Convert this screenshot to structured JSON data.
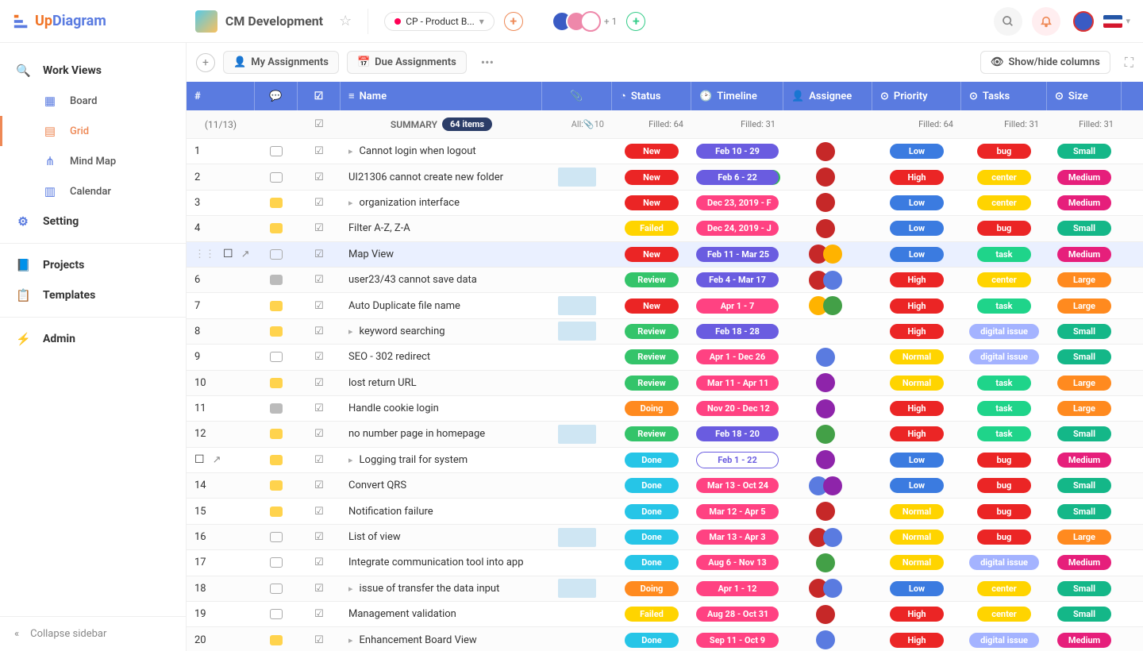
{
  "header": {
    "logo1": "Up",
    "logo2": "Diagram",
    "project": "CM Development",
    "phase": "CP - Product B...",
    "avatar_plus": "+ 1",
    "flag": "en"
  },
  "sidebar": {
    "work_views": "Work Views",
    "items": [
      {
        "icon": "board",
        "label": "Board"
      },
      {
        "icon": "grid",
        "label": "Grid"
      },
      {
        "icon": "mindmap",
        "label": "Mind Map"
      },
      {
        "icon": "calendar",
        "label": "Calendar"
      }
    ],
    "setting": "Setting",
    "projects": "Projects",
    "templates": "Templates",
    "admin": "Admin",
    "collapse": "Collapse sidebar"
  },
  "toolbar": {
    "my_assign": "My Assignments",
    "due_assign": "Due Assignments",
    "showhide": "Show/hide columns"
  },
  "columns": {
    "num": "#",
    "name": "Name",
    "status": "Status",
    "timeline": "Timeline",
    "assignee": "Assignee",
    "priority": "Priority",
    "tasks": "Tasks",
    "size": "Size"
  },
  "summary": {
    "frac": "(11/13)",
    "label": "SUMMARY",
    "count": "64 items",
    "att": "All:",
    "att_n": "10",
    "status": "Filled: 64",
    "timeline": "Filled: 31",
    "priority": "Filled: 64",
    "tasks": "Filled: 31",
    "size": "Filled: 31"
  },
  "colors": {
    "red": "#eb2525",
    "green": "#34c46a",
    "lime": "#1fd48a",
    "yellow": "#ffd400",
    "orange": "#ff8a1f",
    "cyan": "#26c5e7",
    "purple": "#6a5ce0",
    "violet": "#9a52e0",
    "pink": "#e646a4",
    "magenta": "#e61f7b",
    "blue": "#3b7be0",
    "teal": "#14b788",
    "pinkred": "#ff4282",
    "lav": "#a4b3ff",
    "dblue": "#4d6cf0"
  },
  "rows": [
    {
      "n": "1",
      "chat": "empty",
      "name": "Cannot login when logout",
      "caret": true,
      "att": 0,
      "status": {
        "t": "New",
        "c": "red"
      },
      "time": {
        "t": "Feb 10 - 29",
        "c": "purple"
      },
      "asg": [
        "a1"
      ],
      "pri": {
        "t": "Low",
        "c": "blue"
      },
      "task": {
        "t": "bug",
        "c": "red"
      },
      "size": {
        "t": "Small",
        "c": "teal"
      }
    },
    {
      "n": "2",
      "chat": "empty",
      "name": "UI21306 cannot create new folder",
      "caret": false,
      "att": 1,
      "status": {
        "t": "New",
        "c": "red"
      },
      "time": {
        "t": "Feb 6 - 22",
        "c": "purple",
        "sel": true
      },
      "asg": [
        "a1"
      ],
      "pri": {
        "t": "High",
        "c": "red"
      },
      "task": {
        "t": "center",
        "c": "yellow"
      },
      "size": {
        "t": "Medium",
        "c": "magenta"
      }
    },
    {
      "n": "3",
      "chat": "yellow",
      "name": "organization interface",
      "caret": true,
      "att": 0,
      "status": {
        "t": "New",
        "c": "red"
      },
      "time": {
        "t": "Dec 23, 2019 - F",
        "c": "pinkred"
      },
      "asg": [
        "a1"
      ],
      "pri": {
        "t": "Low",
        "c": "blue"
      },
      "task": {
        "t": "center",
        "c": "yellow"
      },
      "size": {
        "t": "Medium",
        "c": "magenta"
      }
    },
    {
      "n": "4",
      "chat": "yellow",
      "name": "Filter A-Z, Z-A",
      "caret": false,
      "att": 0,
      "status": {
        "t": "Failed",
        "c": "yellow"
      },
      "time": {
        "t": "Dec 24, 2019 - J",
        "c": "pinkred"
      },
      "asg": [
        "a1"
      ],
      "pri": {
        "t": "Low",
        "c": "blue"
      },
      "task": {
        "t": "bug",
        "c": "red"
      },
      "size": {
        "t": "Small",
        "c": "teal"
      }
    },
    {
      "n": "",
      "chat": "empty",
      "name": "Map View",
      "caret": false,
      "att": 0,
      "status": {
        "t": "New",
        "c": "red"
      },
      "time": {
        "t": "Feb 11 - Mar 25",
        "c": "purple"
      },
      "asg": [
        "a1",
        "a2"
      ],
      "pri": {
        "t": "Low",
        "c": "blue"
      },
      "task": {
        "t": "task",
        "c": "lime"
      },
      "size": {
        "t": "Medium",
        "c": "magenta"
      },
      "hov": true,
      "checkbox": true,
      "open": true
    },
    {
      "n": "6",
      "chat": "gray",
      "name": "user23/43 cannot save data",
      "caret": false,
      "att": 0,
      "status": {
        "t": "Review",
        "c": "green"
      },
      "time": {
        "t": "Feb 4 - Mar 17",
        "c": "purple"
      },
      "asg": [
        "a1",
        "a3"
      ],
      "pri": {
        "t": "High",
        "c": "red"
      },
      "task": {
        "t": "center",
        "c": "yellow"
      },
      "size": {
        "t": "Large",
        "c": "orange"
      }
    },
    {
      "n": "7",
      "chat": "yellow",
      "name": "Auto Duplicate file name",
      "caret": false,
      "att": 1,
      "status": {
        "t": "New",
        "c": "red"
      },
      "time": {
        "t": "Apr 1 - 7",
        "c": "pinkred"
      },
      "asg": [
        "a2",
        "a5"
      ],
      "pri": {
        "t": "High",
        "c": "red"
      },
      "task": {
        "t": "task",
        "c": "lime"
      },
      "size": {
        "t": "Large",
        "c": "orange"
      }
    },
    {
      "n": "8",
      "chat": "yellow",
      "name": "keyword searching",
      "caret": true,
      "att": 1,
      "status": {
        "t": "Review",
        "c": "green"
      },
      "time": {
        "t": "Feb 18 - 28",
        "c": "purple"
      },
      "asg": [],
      "pri": {
        "t": "High",
        "c": "red"
      },
      "task": {
        "t": "digital issue",
        "c": "lav"
      },
      "size": {
        "t": "Small",
        "c": "teal"
      }
    },
    {
      "n": "9",
      "chat": "empty",
      "name": "SEO - 302 redirect",
      "caret": false,
      "att": 0,
      "status": {
        "t": "Review",
        "c": "green"
      },
      "time": {
        "t": "Apr 1 - Dec 26",
        "c": "pinkred"
      },
      "asg": [
        "a3"
      ],
      "pri": {
        "t": "Normal",
        "c": "yellow"
      },
      "task": {
        "t": "digital issue",
        "c": "lav"
      },
      "size": {
        "t": "Small",
        "c": "teal"
      }
    },
    {
      "n": "10",
      "chat": "yellow",
      "name": "lost return URL",
      "caret": false,
      "att": 0,
      "status": {
        "t": "Review",
        "c": "green"
      },
      "time": {
        "t": "Mar 11 - Apr 11",
        "c": "pinkred"
      },
      "asg": [
        "a4"
      ],
      "pri": {
        "t": "Normal",
        "c": "yellow"
      },
      "task": {
        "t": "task",
        "c": "lime"
      },
      "size": {
        "t": "Large",
        "c": "orange"
      }
    },
    {
      "n": "11",
      "chat": "gray",
      "name": "Handle cookie login",
      "caret": false,
      "att": 0,
      "status": {
        "t": "Doing",
        "c": "orange"
      },
      "time": {
        "t": "Nov 20 - Dec 12",
        "c": "pinkred"
      },
      "asg": [
        "a4"
      ],
      "pri": {
        "t": "High",
        "c": "red"
      },
      "task": {
        "t": "task",
        "c": "lime"
      },
      "size": {
        "t": "Large",
        "c": "orange"
      }
    },
    {
      "n": "12",
      "chat": "yellow",
      "name": "no number page in homepage",
      "caret": false,
      "att": 1,
      "status": {
        "t": "Review",
        "c": "green"
      },
      "time": {
        "t": "Feb 18 - 20",
        "c": "purple"
      },
      "asg": [
        "a5"
      ],
      "pri": {
        "t": "High",
        "c": "red"
      },
      "task": {
        "t": "task",
        "c": "lime"
      },
      "size": {
        "t": "Small",
        "c": "teal"
      }
    },
    {
      "n": "",
      "chat": "yellow",
      "name": "Logging trail for system",
      "caret": true,
      "att": 0,
      "status": {
        "t": "Done",
        "c": "cyan"
      },
      "time": {
        "t": "Feb 1 - 22",
        "c": "purple",
        "boxed": true
      },
      "asg": [
        "a4"
      ],
      "pri": {
        "t": "Low",
        "c": "blue"
      },
      "task": {
        "t": "bug",
        "c": "red"
      },
      "size": {
        "t": "Medium",
        "c": "magenta"
      },
      "checkbox": true,
      "open": true
    },
    {
      "n": "14",
      "chat": "yellow",
      "name": "Convert QRS",
      "caret": false,
      "att": 0,
      "status": {
        "t": "Done",
        "c": "cyan"
      },
      "time": {
        "t": "Mar 13 - Oct 24",
        "c": "pinkred"
      },
      "asg": [
        "a3",
        "a4"
      ],
      "pri": {
        "t": "Low",
        "c": "blue"
      },
      "task": {
        "t": "bug",
        "c": "red"
      },
      "size": {
        "t": "Small",
        "c": "teal"
      }
    },
    {
      "n": "15",
      "chat": "yellow",
      "name": "Notification failure",
      "caret": false,
      "att": 0,
      "status": {
        "t": "Done",
        "c": "cyan"
      },
      "time": {
        "t": "Mar 12 - Apr 5",
        "c": "pinkred"
      },
      "asg": [
        "a1"
      ],
      "pri": {
        "t": "Normal",
        "c": "yellow"
      },
      "task": {
        "t": "bug",
        "c": "red"
      },
      "size": {
        "t": "Small",
        "c": "teal"
      }
    },
    {
      "n": "16",
      "chat": "empty",
      "name": "List of view",
      "caret": false,
      "att": 1,
      "status": {
        "t": "Done",
        "c": "cyan"
      },
      "time": {
        "t": "Mar 13 - Apr 3",
        "c": "pinkred"
      },
      "asg": [
        "a1",
        "a3"
      ],
      "pri": {
        "t": "Normal",
        "c": "yellow"
      },
      "task": {
        "t": "bug",
        "c": "red"
      },
      "size": {
        "t": "Large",
        "c": "orange"
      }
    },
    {
      "n": "17",
      "chat": "empty",
      "name": "Integrate communication tool into app",
      "caret": false,
      "att": 0,
      "status": {
        "t": "Done",
        "c": "cyan"
      },
      "time": {
        "t": "Aug 6 - Nov 13",
        "c": "pinkred"
      },
      "asg": [
        "a5"
      ],
      "pri": {
        "t": "Normal",
        "c": "yellow"
      },
      "task": {
        "t": "digital issue",
        "c": "lav"
      },
      "size": {
        "t": "Medium",
        "c": "magenta"
      }
    },
    {
      "n": "18",
      "chat": "empty",
      "name": "issue of transfer the data input",
      "caret": true,
      "att": 1,
      "status": {
        "t": "Doing",
        "c": "orange"
      },
      "time": {
        "t": "Apr 1 - 12",
        "c": "pinkred"
      },
      "asg": [
        "a1",
        "a3"
      ],
      "pri": {
        "t": "Low",
        "c": "blue"
      },
      "task": {
        "t": "center",
        "c": "yellow"
      },
      "size": {
        "t": "Small",
        "c": "teal"
      }
    },
    {
      "n": "19",
      "chat": "empty",
      "name": "Management validation",
      "caret": false,
      "att": 0,
      "status": {
        "t": "Failed",
        "c": "yellow"
      },
      "time": {
        "t": "Aug 28 - Oct 31",
        "c": "pinkred"
      },
      "asg": [
        "a1"
      ],
      "pri": {
        "t": "High",
        "c": "red"
      },
      "task": {
        "t": "center",
        "c": "yellow"
      },
      "size": {
        "t": "Small",
        "c": "teal"
      }
    },
    {
      "n": "20",
      "chat": "yellow",
      "name": "Enhancement Board View",
      "caret": true,
      "att": 0,
      "status": {
        "t": "Done",
        "c": "cyan"
      },
      "time": {
        "t": "Sep 11 - Oct 9",
        "c": "pinkred"
      },
      "asg": [
        "a3"
      ],
      "pri": {
        "t": "High",
        "c": "red"
      },
      "task": {
        "t": "digital issue",
        "c": "lav"
      },
      "size": {
        "t": "Medium",
        "c": "magenta"
      }
    }
  ]
}
